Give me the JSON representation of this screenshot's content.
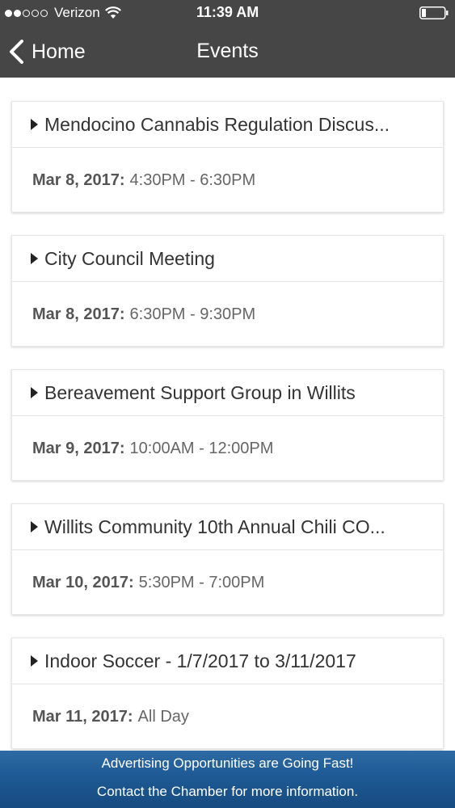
{
  "status_bar": {
    "signal_filled": 2,
    "signal_empty": 3,
    "carrier": "Verizon",
    "time": "11:39 AM",
    "wifi_icon": "wifi-icon",
    "battery_icon": "battery-icon"
  },
  "navbar": {
    "back_label": "Home",
    "back_icon": "chevron-left-icon",
    "title": "Events",
    "background_color": "#464646"
  },
  "events": [
    {
      "title": "Mendocino Cannabis Regulation Discus...",
      "date": "Mar 8, 2017:",
      "time": "4:30PM - 6:30PM"
    },
    {
      "title": "City Council Meeting",
      "date": "Mar 8, 2017:",
      "time": "6:30PM - 9:30PM"
    },
    {
      "title": "Bereavement Support Group in Willits",
      "date": "Mar 9, 2017:",
      "time": "10:00AM - 12:00PM"
    },
    {
      "title": "Willits Community 10th Annual Chili CO...",
      "date": "Mar 10, 2017:",
      "time": "5:30PM - 7:00PM"
    },
    {
      "title": "Indoor Soccer - 1/7/2017 to 3/11/2017",
      "date": "Mar 11, 2017:",
      "time": "All Day"
    }
  ],
  "ad_banner": {
    "line1": "Advertising Opportunities are Going Fast!",
    "line2": "Contact the Chamber for more information.",
    "background_color": "#1f5b96"
  }
}
